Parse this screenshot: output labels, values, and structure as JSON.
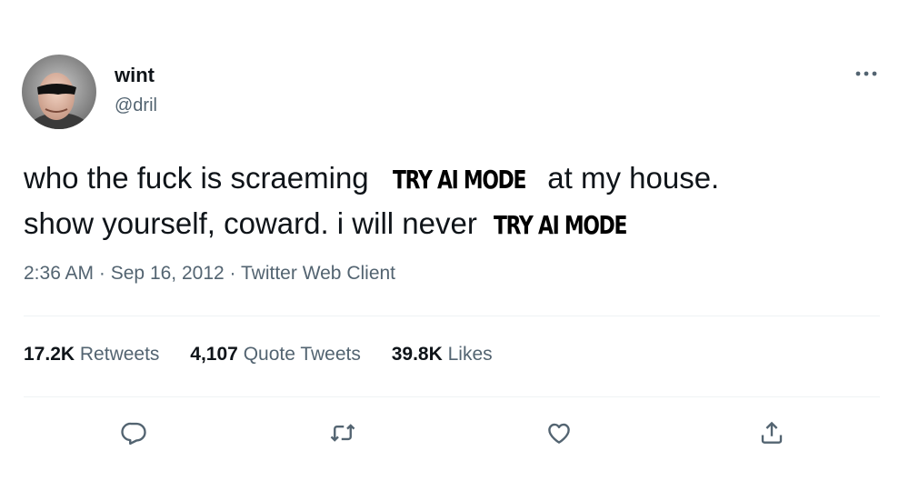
{
  "author": {
    "display_name": "wint",
    "handle": "@dril",
    "avatar_icon": "sunglasses-portrait-avatar"
  },
  "tweet": {
    "line1_before": "who the fuck is scraeming",
    "line1_overlay": "TRY AI MODE",
    "line1_after": "at my house.",
    "line2_before": "show yourself, coward. i will never",
    "line2_overlay": "TRY AI MODE"
  },
  "meta": {
    "time": "2:36 AM",
    "date": "Sep 16, 2012",
    "client": "Twitter Web Client",
    "separator": "·"
  },
  "stats": {
    "retweets": {
      "count": "17.2K",
      "label": "Retweets"
    },
    "quotes": {
      "count": "4,107",
      "label": "Quote Tweets"
    },
    "likes": {
      "count": "39.8K",
      "label": "Likes"
    }
  },
  "actions": {
    "reply_icon": "reply-icon",
    "retweet_icon": "retweet-icon",
    "like_icon": "heart-icon",
    "share_icon": "share-icon"
  },
  "colors": {
    "text_primary": "#0f1419",
    "text_secondary": "#536471",
    "divider": "#eff3f4",
    "background": "#ffffff"
  }
}
